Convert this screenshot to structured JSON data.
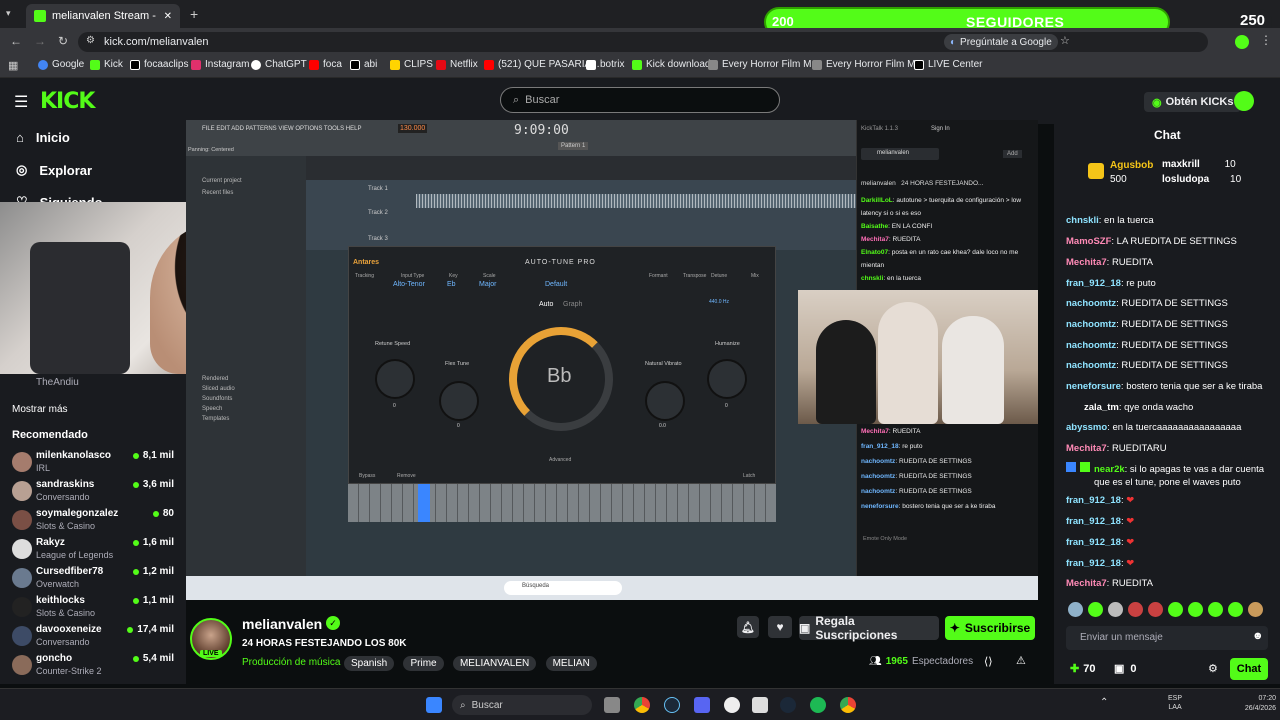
{
  "browser": {
    "tabs": [
      {
        "label": "melianvalen Stream - Watc",
        "active": true
      }
    ],
    "url": "kick.com/melianvalen",
    "google_prompt": "Pregúntale a Google",
    "bookmarks": [
      "Google",
      "Kick",
      "focaaclips",
      "Instagram",
      "ChatGPT",
      "foca",
      "abi",
      "CLIPS",
      "Netflix",
      "(521) QUE PASARIA...",
      "botrix",
      "Kick download",
      "Every Horror Film M...",
      "Every Horror Film M...",
      "LIVE Center"
    ]
  },
  "overlay": {
    "followers_current": "200",
    "followers_label": "SEGUIDORES",
    "followers_goal": "250",
    "progress": 0.8
  },
  "header": {
    "logo": "KICK",
    "search_placeholder": "Buscar",
    "kicks_button": "Obtén KICKs"
  },
  "sidebar": {
    "nav": [
      {
        "label": "Inicio",
        "icon": "home-icon"
      },
      {
        "label": "Explorar",
        "icon": "compass-icon"
      },
      {
        "label": "Siguiendo",
        "icon": "heart-icon"
      }
    ],
    "followed_partial": "TheAndiu",
    "show_more": "Mostrar más",
    "recommended_title": "Recomendado",
    "recommended": [
      {
        "name": "milenkanolasco",
        "category": "IRL",
        "viewers": "8,1 mil"
      },
      {
        "name": "sandraskins",
        "category": "Conversando",
        "viewers": "3,6 mil"
      },
      {
        "name": "soymalegonzalez",
        "category": "Slots & Casino",
        "viewers": "80"
      },
      {
        "name": "Rakyz",
        "category": "League of Legends",
        "viewers": "1,6 mil"
      },
      {
        "name": "Cursedfiber78",
        "category": "Overwatch",
        "viewers": "1,2 mil"
      },
      {
        "name": "keithlocks",
        "category": "Slots & Casino",
        "viewers": "1,1 mil"
      },
      {
        "name": "davooxeneize",
        "category": "Conversando",
        "viewers": "17,4 mil"
      },
      {
        "name": "goncho",
        "category": "Counter-Strike 2",
        "viewers": "5,4 mil"
      }
    ]
  },
  "stream_content": {
    "daw_menu": "FILE EDIT ADD PATTERNS VIEW OPTIONS TOOLS HELP",
    "daw_time": "9:09:00",
    "daw_tempo": "130.000",
    "daw_pattern": "Pattern 1",
    "panning": "Panning: Centered",
    "browser_items": [
      "Current project",
      "Recent files",
      "Rendered",
      "Sliced audio",
      "Soundfonts",
      "Speech",
      "Templates"
    ],
    "track_names": [
      "Track 1",
      "Track 2",
      "Track 3"
    ],
    "plugin_title": "AUTO-TUNE PRO",
    "plugin_brand": "Antares",
    "plugin_key_labels": [
      "Tracking",
      "Input Type",
      "Key",
      "Scale",
      "Formant",
      "Transpose",
      "Detune",
      "Mix"
    ],
    "plugin_values": [
      "Alto-Tenor",
      "Eb",
      "Major",
      "440.0 Hz"
    ],
    "plugin_preset": "Default",
    "plugin_modes": [
      "Auto",
      "Graph"
    ],
    "plugin_note": "Bb",
    "plugin_knobs": [
      {
        "label": "Retune Speed",
        "value": "0"
      },
      {
        "label": "Flex Tune",
        "value": "0"
      },
      {
        "label": "Natural Vibrato",
        "value": "0.0"
      },
      {
        "label": "Humanize",
        "value": "0"
      }
    ],
    "plugin_bottom": [
      "Bypass",
      "Remove",
      "Advanced",
      "Latch"
    ],
    "kicktalk": {
      "title": "KickTalk 1.1.3",
      "signin": "Sign In",
      "channel": "melianvalen",
      "add": "Add",
      "stream_title": "24 HORAS FESTEJANDO...",
      "emote_only": "Emote Only Mode",
      "messages": [
        {
          "user": "DarkillLoL",
          "text": "autotune > tuerquita de configuración > low latency si o si es eso",
          "color": "#53fc18"
        },
        {
          "user": "Baisathe",
          "text": "EN LA CONFI",
          "color": "#53fc18"
        },
        {
          "user": "Mechita7",
          "text": "RUEDITA",
          "color": "#ff6fb7"
        },
        {
          "user": "Elnato07",
          "text": "posta en un rato cae khea? dale loco no me mientan",
          "color": "#53fc18"
        },
        {
          "user": "chnskli",
          "text": "en la tuerca",
          "color": "#53fc18"
        },
        {
          "user": "Mechita7",
          "text": "RUEDITA",
          "color": "#ff6fb7"
        },
        {
          "user": "fran_912_18",
          "text": "re puto",
          "color": "#6fb7ff"
        },
        {
          "user": "nachoomtz",
          "text": "RUEDITA DE SETTINGS",
          "color": "#6fb7ff"
        },
        {
          "user": "nachoomtz",
          "text": "RUEDITA DE SETTINGS",
          "color": "#6fb7ff"
        },
        {
          "user": "nachoomtz",
          "text": "RUEDITA DE SETTINGS",
          "color": "#6fb7ff"
        },
        {
          "user": "neneforsure",
          "text": "bostero tenia que ser a ke tiraba",
          "color": "#6fb7ff"
        }
      ]
    },
    "taskbar_search": "Búsqueda"
  },
  "channel": {
    "name": "melianvalen",
    "title": "24 HORAS FESTEJANDO LOS 80K",
    "category": "Producción de música",
    "tags": [
      "Spanish",
      "Prime",
      "MELIANVALEN",
      "MELIAN"
    ],
    "live_badge": "LIVE",
    "gift_button": "Regala Suscripciones",
    "subscribe_button": "Suscribirse",
    "viewers": "1965",
    "viewers_label": "Espectadores"
  },
  "chat": {
    "title": "Chat",
    "leaderboard": [
      {
        "name": "Agusbob",
        "points": "500"
      },
      {
        "name": "maxkrill",
        "points": "10"
      },
      {
        "name": "losludopa",
        "points": "10"
      }
    ],
    "messages": [
      {
        "user": "chnskli",
        "text": "en la tuerca",
        "color": "#8fe3ff"
      },
      {
        "user": "MamoSZF",
        "text": "LA RUEDITA DE SETTINGS",
        "color": "#ff8ab6"
      },
      {
        "user": "Mechita7",
        "text": "RUEDITA",
        "color": "#ff8ab6"
      },
      {
        "user": "fran_912_18",
        "text": "re puto",
        "color": "#8fe3ff"
      },
      {
        "user": "nachoomtz",
        "text": "RUEDITA DE SETTINGS",
        "color": "#8fe3ff"
      },
      {
        "user": "nachoomtz",
        "text": "RUEDITA DE SETTINGS",
        "color": "#8fe3ff"
      },
      {
        "user": "nachoomtz",
        "text": "RUEDITA DE SETTINGS",
        "color": "#8fe3ff"
      },
      {
        "user": "nachoomtz",
        "text": "RUEDITA DE SETTINGS",
        "color": "#8fe3ff"
      },
      {
        "user": "neneforsure",
        "text": "bostero tenia que ser a ke tiraba",
        "color": "#8fe3ff"
      },
      {
        "user": "zala_tm",
        "text": "qye onda wacho",
        "color": "#ffffff"
      },
      {
        "user": "abyssmo",
        "text": "en la tuercaaaaaaaaaaaaaaaa",
        "color": "#8fe3ff"
      },
      {
        "user": "Mechita7",
        "text": "RUEDITARU",
        "color": "#ff8ab6"
      },
      {
        "user": "near2k",
        "text": "si lo apagas te vas a dar cuenta que es el tune, pone el waves puto",
        "color": "#53fc18"
      },
      {
        "user": "fran_912_18",
        "text": "",
        "color": "#8fe3ff"
      },
      {
        "user": "fran_912_18",
        "text": "",
        "color": "#8fe3ff"
      },
      {
        "user": "fran_912_18",
        "text": "",
        "color": "#8fe3ff"
      },
      {
        "user": "fran_912_18",
        "text": "",
        "color": "#8fe3ff"
      },
      {
        "user": "Mechita7",
        "text": "RUEDITA",
        "color": "#ff8ab6"
      }
    ],
    "input_placeholder": "Enviar un mensaje",
    "points": "70",
    "gifts": "0",
    "send_button": "Chat"
  },
  "taskbar": {
    "search": "Buscar",
    "lang": "ESP",
    "lang2": "LAA",
    "time": "07:20",
    "date": "26/4/2026"
  }
}
